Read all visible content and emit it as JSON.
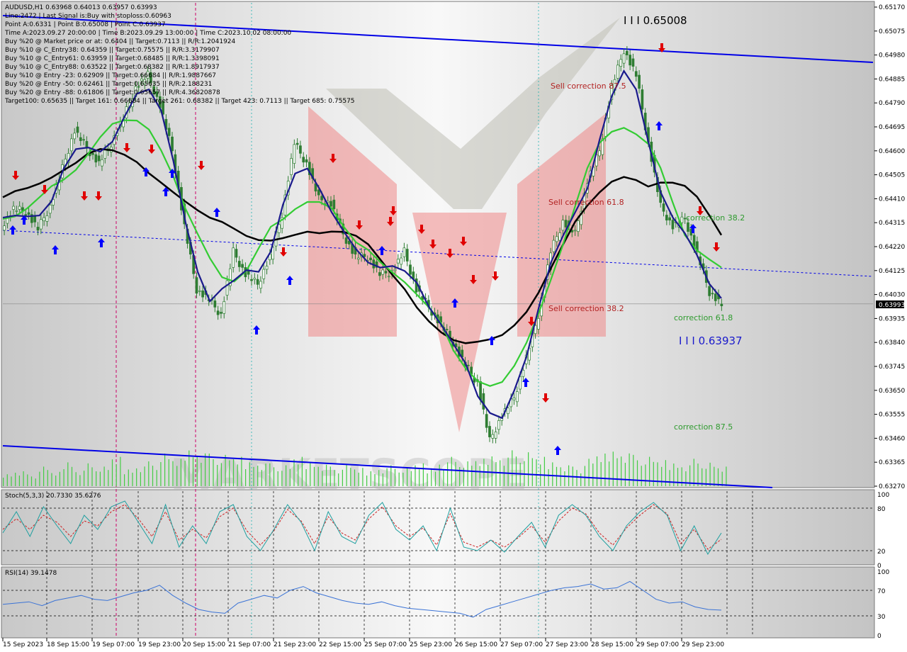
{
  "info": {
    "lines": [
      "AUDUSD,H1  0.63968 0.64013 0.63957 0.63993",
      "Line:2472 | Last Signal is:Buy with stoploss:0.60963",
      "Point A:0.6331 | Point B:0.65008 | Point C:0.63937",
      "Time A:2023.09.27 20:00:00 | Time B:2023.09.29 13:00:00 | Time C:2023.10.02 08:00:00",
      "Buy %20 @ Market price or at: 0.6404 || Target:0.7113 || R/R:1.2041924",
      "Buy %10 @ C_Entry38: 0.64359 || Target:0.75575 || R/R:3.3179907",
      "Buy %10 @ C_Entry61: 0.63959 || Target:0.68485 || R/R:1.3398091",
      "Buy %10 @ C_Entry88: 0.63522 || Target:0.68382 || R/R:1.8917937",
      "Buy %10 @ Entry -23: 0.62909 || Target:0.66684 || R/R:1.9887667",
      "Buy %20 @ Entry -50: 0.62461 || Target:0.65635 || R/R:2.188231",
      "Buy %20 @ Entry -88: 0.61806 || Target:0.65657 || R/R:4.36820878",
      "Target100: 0.65635 || Target 161: 0.66684 || Target 261: 0.68382 || Target 423: 0.7113 || Target 685: 0.75575"
    ]
  },
  "annotations": {
    "sell_875": "Sell correction 87.5",
    "sell_618": "Sell correction 61.8",
    "sell_382": "Sell correction 38.2",
    "corr_382": "correction 38.2",
    "corr_618": "correction 61.8",
    "corr_875": "correction 87.5",
    "point_b": "I I I 0.65008",
    "point_c": "I I I 0.63937"
  },
  "chart_data": [
    {
      "type": "candlestick",
      "symbol": "AUDUSD",
      "timeframe": "H1",
      "title": "AUDUSD,H1",
      "last_price": "0.63993",
      "ylim": [
        0.6327,
        0.6517
      ],
      "y_ticks": [
        "0.65170",
        "0.65075",
        "0.64980",
        "0.64885",
        "0.64790",
        "0.64695",
        "0.64600",
        "0.64505",
        "0.64410",
        "0.64315",
        "0.64220",
        "0.64125",
        "0.64030",
        "0.63935",
        "0.63840",
        "0.63745",
        "0.63650",
        "0.63555",
        "0.63460",
        "0.63365",
        "0.63270"
      ],
      "x_ticks": [
        "15 Sep 2023",
        "18 Sep 15:00",
        "19 Sep 07:00",
        "19 Sep 23:00",
        "20 Sep 15:00",
        "21 Sep 07:00",
        "21 Sep 23:00",
        "22 Sep 15:00",
        "25 Sep 07:00",
        "25 Sep 23:00",
        "26 Sep 15:00",
        "27 Sep 07:00",
        "27 Sep 23:00",
        "28 Sep 15:00",
        "29 Sep 07:00",
        "29 Sep 23:00"
      ],
      "close_path": [
        0.643,
        0.6437,
        0.6436,
        0.6429,
        0.6438,
        0.6453,
        0.6468,
        0.6461,
        0.6455,
        0.6463,
        0.6473,
        0.6485,
        0.649,
        0.6478,
        0.646,
        0.643,
        0.6405,
        0.6401,
        0.6395,
        0.642,
        0.6411,
        0.6407,
        0.6418,
        0.6435,
        0.6463,
        0.6455,
        0.6441,
        0.6439,
        0.6427,
        0.6418,
        0.6418,
        0.6411,
        0.6412,
        0.642,
        0.6405,
        0.6398,
        0.6391,
        0.6384,
        0.6375,
        0.6368,
        0.6345,
        0.6355,
        0.6362,
        0.6378,
        0.6395,
        0.642,
        0.6432,
        0.6427,
        0.6448,
        0.646,
        0.6485,
        0.65,
        0.649,
        0.6463,
        0.6438,
        0.643,
        0.6433,
        0.6419,
        0.6404,
        0.6399
      ],
      "fib_levels": {
        "point_a": 0.6331,
        "point_b": 0.65008,
        "point_c": 0.63937
      },
      "stochastic": {
        "label": "Stoch(5,3,3) 20.7330 35.6276",
        "ylim": [
          0,
          100
        ],
        "y_ticks": [
          "100",
          "80",
          "20",
          "0"
        ],
        "k_path": [
          45,
          75,
          40,
          82,
          55,
          30,
          70,
          50,
          82,
          90,
          60,
          30,
          85,
          25,
          55,
          30,
          75,
          85,
          40,
          20,
          50,
          85,
          60,
          20,
          75,
          40,
          30,
          70,
          88,
          50,
          35,
          55,
          20,
          80,
          25,
          20,
          35,
          18,
          40,
          60,
          25,
          70,
          85,
          70,
          40,
          20,
          55,
          75,
          88,
          70,
          20,
          55,
          15,
          45
        ],
        "d_path": [
          50,
          65,
          50,
          70,
          60,
          40,
          62,
          55,
          75,
          85,
          65,
          40,
          75,
          35,
          50,
          38,
          68,
          80,
          48,
          28,
          48,
          78,
          62,
          30,
          68,
          45,
          35,
          65,
          82,
          55,
          40,
          52,
          28,
          72,
          32,
          25,
          35,
          25,
          38,
          55,
          32,
          62,
          80,
          72,
          45,
          28,
          52,
          70,
          85,
          72,
          30,
          50,
          22,
          36
        ]
      },
      "rsi": {
        "label": "RSI(14) 39.1478",
        "ylim": [
          0,
          100
        ],
        "y_ticks": [
          "100",
          "70",
          "30",
          "0"
        ],
        "path": [
          48,
          50,
          52,
          46,
          54,
          58,
          62,
          56,
          54,
          60,
          66,
          70,
          78,
          62,
          50,
          40,
          36,
          34,
          50,
          56,
          62,
          58,
          70,
          76,
          66,
          60,
          54,
          50,
          48,
          52,
          46,
          42,
          40,
          38,
          36,
          34,
          28,
          40,
          46,
          52,
          58,
          64,
          70,
          74,
          76,
          80,
          72,
          74,
          84,
          70,
          56,
          50,
          52,
          44,
          40,
          39
        ]
      },
      "volume": [
        20,
        25,
        18,
        30,
        22,
        40,
        26,
        35,
        30,
        45,
        28,
        33,
        38,
        50,
        42,
        60,
        55,
        50,
        48,
        45,
        40,
        38,
        35,
        32,
        45,
        40,
        36,
        30,
        34,
        28,
        25,
        30,
        32,
        28,
        35,
        30,
        40,
        45,
        38,
        42,
        50,
        48,
        55,
        52,
        45,
        40,
        35,
        30,
        42,
        50,
        58,
        55,
        48,
        45,
        40,
        38,
        35,
        42,
        36,
        30
      ],
      "series": [
        {
          "name": "",
          "color": "#000000"
        },
        {
          "name": "",
          "color": "#1a1a8c"
        },
        {
          "name": "",
          "color": "#33cc33"
        }
      ]
    }
  ],
  "colors": {
    "candle": "#2e7d32",
    "ma_black": "#000000",
    "ma_navy": "#1a1a8c",
    "ma_green": "#33cc33",
    "trend_blue": "#0000e6",
    "buy_arrow": "#0000ff",
    "sell_arrow": "#e00000",
    "sell_text": "#b22222",
    "corr_text": "#2e9b2e",
    "volume": "#44cc44",
    "stoch_k": "#20a0a0",
    "stoch_d": "#cc2222",
    "rsi": "#3b73d6",
    "grid_dash": "#000000",
    "vline_magenta": "#cc0066",
    "vline_cyan": "#00aaaa",
    "pricebox": "#000000"
  }
}
